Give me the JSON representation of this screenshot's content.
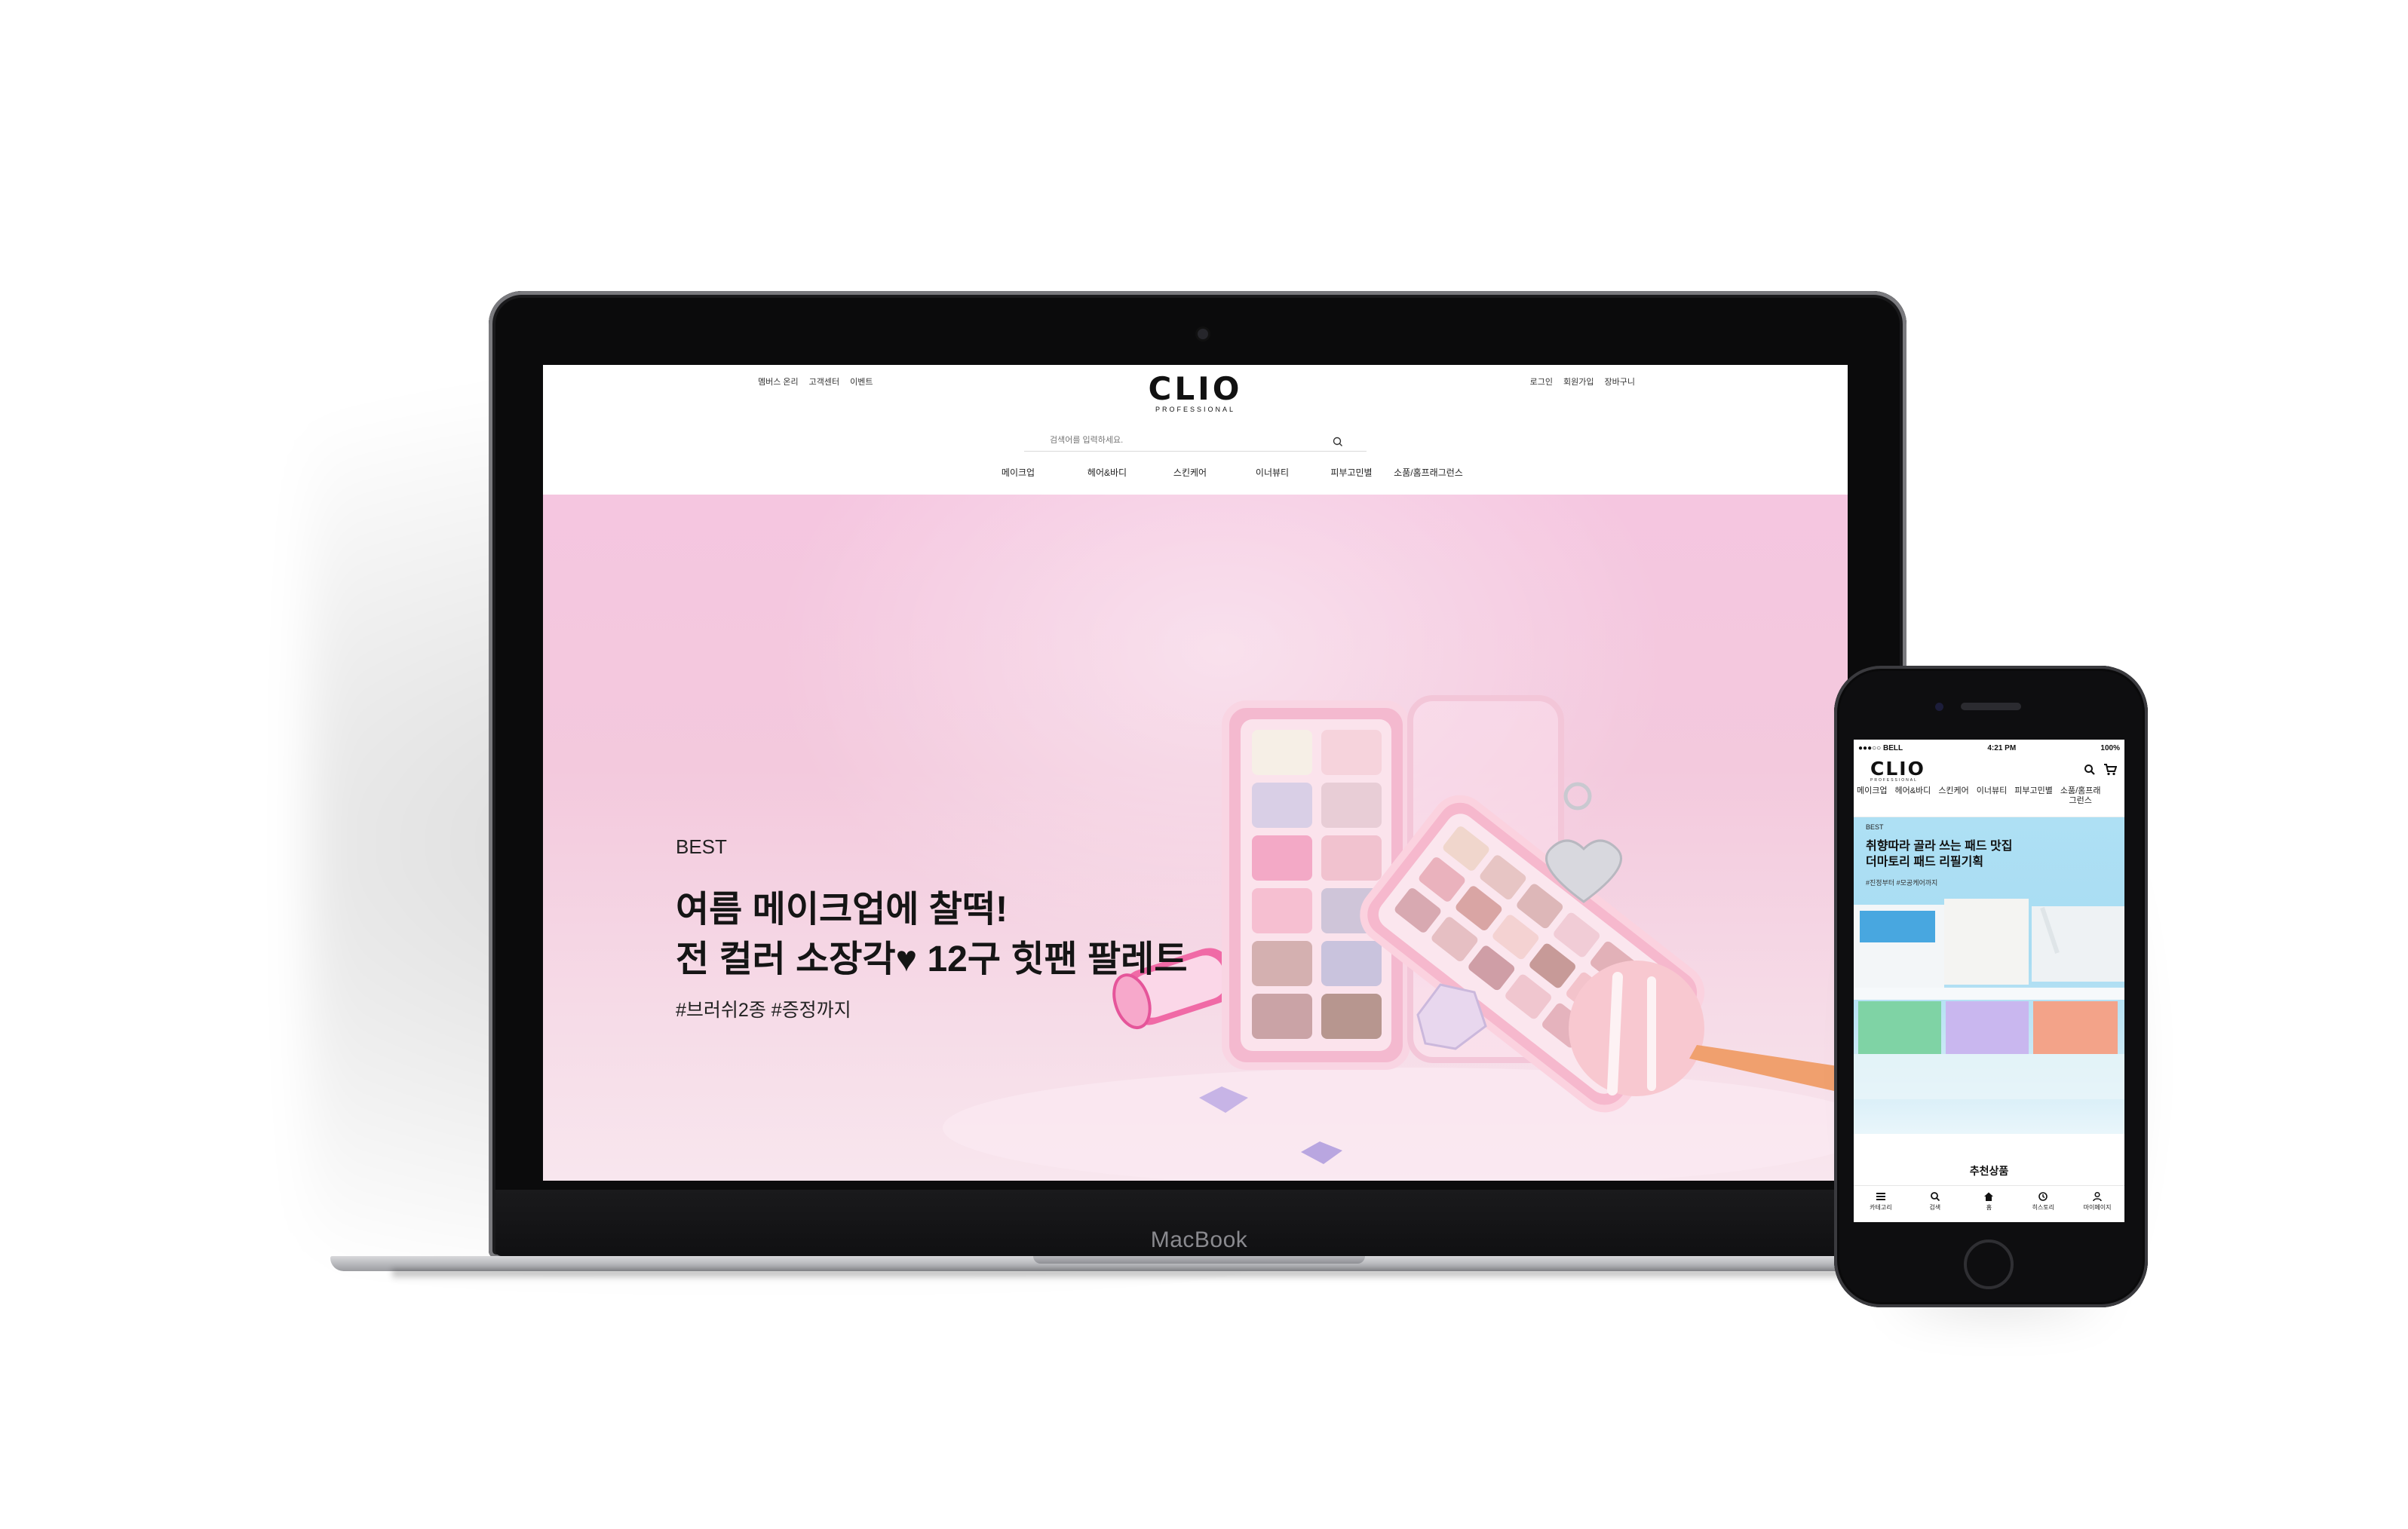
{
  "laptop": {
    "brand_label": "MacBook",
    "site": {
      "util_left": [
        "멤버스 온리",
        "고객센터",
        "이벤트"
      ],
      "util_right": [
        "로그인",
        "회원가입",
        "장바구니"
      ],
      "logo": "CLIO",
      "logo_sub": "PROFESSIONAL",
      "search_placeholder": "검색어를 입력하세요.",
      "nav": [
        "메이크업",
        "헤어&바디",
        "스킨케어",
        "이너뷰티",
        "피부고민별",
        "소품/홈프래그런스"
      ],
      "hero": {
        "badge": "BEST",
        "headline_line1": "여름 메이크업에 찰떡!",
        "headline_line2": "전 컬러 소장각♥ 12구 힛팬 팔레트",
        "tags": "#브러쉬2종 #증정까지"
      }
    }
  },
  "phone": {
    "status": {
      "carrier": "●●●○○ BELL",
      "time": "4:21 PM",
      "battery": "100%"
    },
    "logo": "CLIO",
    "logo_sub": "PROFESSIONAL",
    "menu": [
      "메이크업",
      "헤어&바디",
      "스킨케어",
      "이너뷰티",
      "피부고민별",
      "소품/홈프래\n그런스"
    ],
    "banner": {
      "badge": "BEST",
      "title_line1": "취향따라 골라 쓰는 패드 맛집",
      "title_line2": "더마토리 패드 리필기획",
      "tags": "#진정부터 #모공케어까지"
    },
    "section_title": "추천상품",
    "tabs": [
      {
        "label": "카테고리",
        "icon": "menu-icon"
      },
      {
        "label": "검색",
        "icon": "search-icon"
      },
      {
        "label": "홈",
        "icon": "home-icon"
      },
      {
        "label": "히스토리",
        "icon": "history-icon"
      },
      {
        "label": "마이페이지",
        "icon": "person-icon"
      }
    ]
  },
  "colors": {
    "hero_pink": "#f5c6e0",
    "banner_blue": "#aee0f4",
    "text_dark": "#151515"
  }
}
